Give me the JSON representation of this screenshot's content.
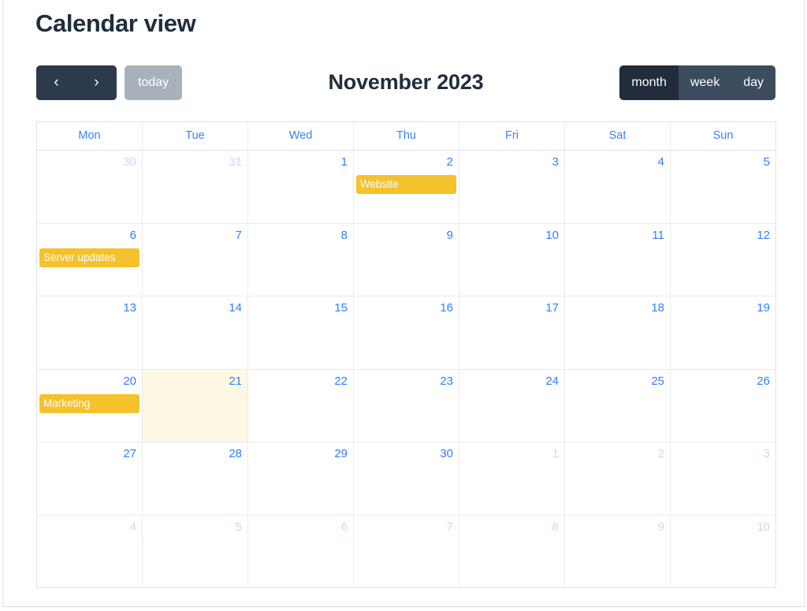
{
  "page": {
    "title": "Calendar view"
  },
  "toolbar": {
    "prev_label": "‹",
    "next_label": "›",
    "today_label": "today",
    "month_title": "November 2023",
    "views": [
      {
        "label": "month",
        "active": true
      },
      {
        "label": "week",
        "active": false
      },
      {
        "label": "day",
        "active": false
      }
    ]
  },
  "calendar": {
    "weekdays": [
      "Mon",
      "Tue",
      "Wed",
      "Thu",
      "Fri",
      "Sat",
      "Sun"
    ],
    "accent_color": "#f5c22c",
    "day_number_color": "#2f80f7",
    "today_background": "#fcf8e3",
    "weeks": [
      [
        {
          "day": "30",
          "other_month": true,
          "today": false,
          "events": []
        },
        {
          "day": "31",
          "other_month": true,
          "today": false,
          "events": []
        },
        {
          "day": "1",
          "other_month": false,
          "today": false,
          "events": []
        },
        {
          "day": "2",
          "other_month": false,
          "today": false,
          "events": [
            "Website"
          ]
        },
        {
          "day": "3",
          "other_month": false,
          "today": false,
          "events": []
        },
        {
          "day": "4",
          "other_month": false,
          "today": false,
          "events": []
        },
        {
          "day": "5",
          "other_month": false,
          "today": false,
          "events": []
        }
      ],
      [
        {
          "day": "6",
          "other_month": false,
          "today": false,
          "events": [
            "Server updates"
          ]
        },
        {
          "day": "7",
          "other_month": false,
          "today": false,
          "events": []
        },
        {
          "day": "8",
          "other_month": false,
          "today": false,
          "events": []
        },
        {
          "day": "9",
          "other_month": false,
          "today": false,
          "events": []
        },
        {
          "day": "10",
          "other_month": false,
          "today": false,
          "events": []
        },
        {
          "day": "11",
          "other_month": false,
          "today": false,
          "events": []
        },
        {
          "day": "12",
          "other_month": false,
          "today": false,
          "events": []
        }
      ],
      [
        {
          "day": "13",
          "other_month": false,
          "today": false,
          "events": []
        },
        {
          "day": "14",
          "other_month": false,
          "today": false,
          "events": []
        },
        {
          "day": "15",
          "other_month": false,
          "today": false,
          "events": []
        },
        {
          "day": "16",
          "other_month": false,
          "today": false,
          "events": []
        },
        {
          "day": "17",
          "other_month": false,
          "today": false,
          "events": []
        },
        {
          "day": "18",
          "other_month": false,
          "today": false,
          "events": []
        },
        {
          "day": "19",
          "other_month": false,
          "today": false,
          "events": []
        }
      ],
      [
        {
          "day": "20",
          "other_month": false,
          "today": false,
          "events": [
            "Marketing"
          ]
        },
        {
          "day": "21",
          "other_month": false,
          "today": true,
          "events": []
        },
        {
          "day": "22",
          "other_month": false,
          "today": false,
          "events": []
        },
        {
          "day": "23",
          "other_month": false,
          "today": false,
          "events": []
        },
        {
          "day": "24",
          "other_month": false,
          "today": false,
          "events": []
        },
        {
          "day": "25",
          "other_month": false,
          "today": false,
          "events": []
        },
        {
          "day": "26",
          "other_month": false,
          "today": false,
          "events": []
        }
      ],
      [
        {
          "day": "27",
          "other_month": false,
          "today": false,
          "events": []
        },
        {
          "day": "28",
          "other_month": false,
          "today": false,
          "events": []
        },
        {
          "day": "29",
          "other_month": false,
          "today": false,
          "events": []
        },
        {
          "day": "30",
          "other_month": false,
          "today": false,
          "events": []
        },
        {
          "day": "1",
          "other_month": true,
          "today": false,
          "events": []
        },
        {
          "day": "2",
          "other_month": true,
          "today": false,
          "events": []
        },
        {
          "day": "3",
          "other_month": true,
          "today": false,
          "events": []
        }
      ],
      [
        {
          "day": "4",
          "other_month": true,
          "today": false,
          "events": []
        },
        {
          "day": "5",
          "other_month": true,
          "today": false,
          "events": []
        },
        {
          "day": "6",
          "other_month": true,
          "today": false,
          "events": []
        },
        {
          "day": "7",
          "other_month": true,
          "today": false,
          "events": []
        },
        {
          "day": "8",
          "other_month": true,
          "today": false,
          "events": []
        },
        {
          "day": "9",
          "other_month": true,
          "today": false,
          "events": []
        },
        {
          "day": "10",
          "other_month": true,
          "today": false,
          "events": []
        }
      ]
    ]
  }
}
